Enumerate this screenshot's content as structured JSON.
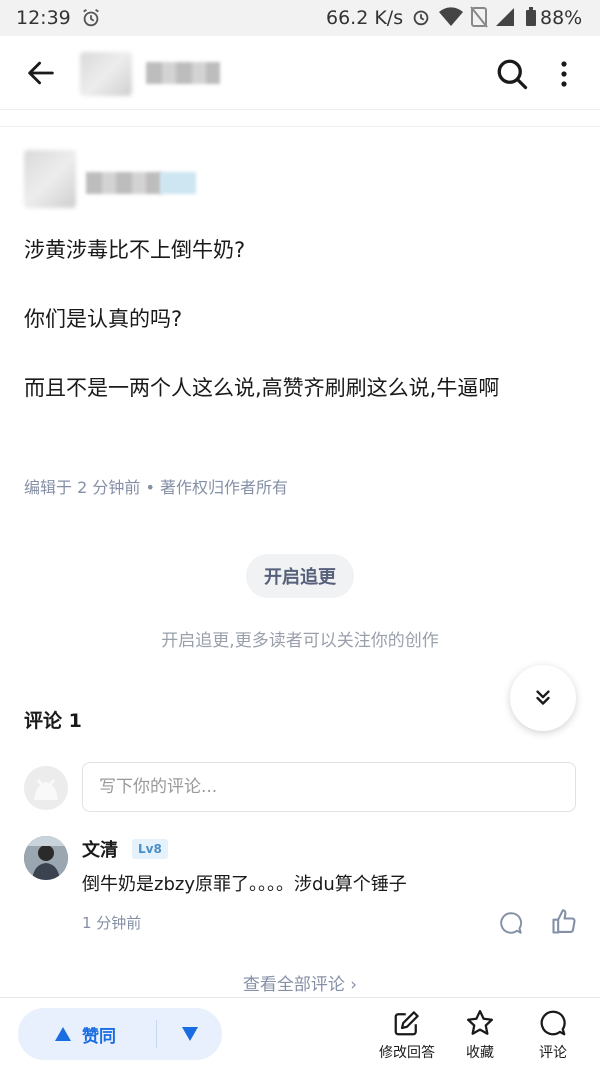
{
  "status_bar": {
    "time": "12:39",
    "network_speed": "66.2 K/s",
    "battery": "88%"
  },
  "answer": {
    "paragraphs": [
      "涉黄涉毒比不上倒牛奶?",
      "你们是认真的吗?",
      "而且不是一两个人这么说,高赞齐刷刷这么说,牛逼啊"
    ],
    "meta": "编辑于 2 分钟前 • 著作权归作者所有"
  },
  "follow": {
    "button_label": "开启追更",
    "hint": "开启追更,更多读者可以关注你的创作"
  },
  "comments": {
    "title": "评论 1",
    "input_placeholder": "写下你的评论...",
    "items": [
      {
        "name": "文清",
        "level": "Lv8",
        "text": "倒牛奶是zbzy原罪了。。。。涉du算个锤子",
        "time": "1 分钟前"
      }
    ],
    "view_all": "查看全部评论 ›"
  },
  "bottom_bar": {
    "upvote_label": "赞同",
    "actions": [
      {
        "label": "修改回答",
        "icon": "edit-icon"
      },
      {
        "label": "收藏",
        "icon": "star-icon"
      },
      {
        "label": "评论",
        "icon": "comment-icon"
      }
    ]
  },
  "colors": {
    "accent": "#1a6de0",
    "meta_gray": "#8590a6",
    "vote_bg": "#e8f0fd"
  }
}
